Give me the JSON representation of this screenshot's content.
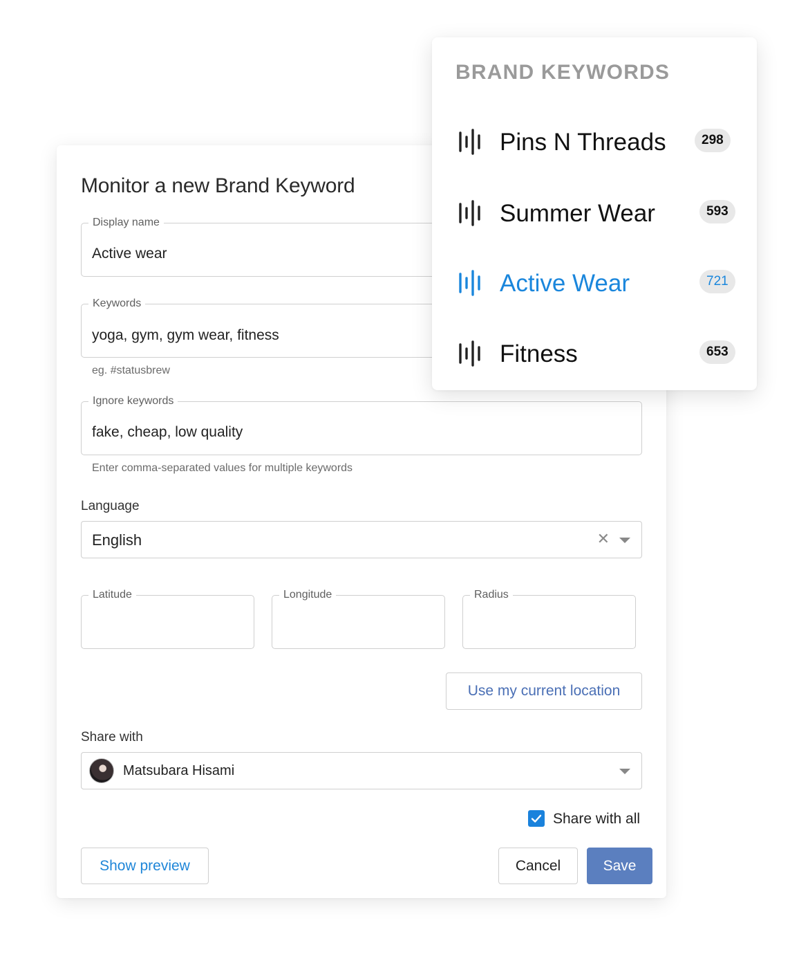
{
  "form": {
    "title": "Monitor a new Brand Keyword",
    "display_name": {
      "label": "Display name",
      "value": "Active wear"
    },
    "keywords": {
      "label": "Keywords",
      "value": "yoga, gym, gym wear, fitness",
      "helper": "eg. #statusbrew"
    },
    "ignore_keywords": {
      "label": "Ignore keywords",
      "value": "fake, cheap, low quality",
      "helper": "Enter comma-separated values for multiple keywords"
    },
    "language": {
      "label": "Language",
      "value": "English",
      "clear_icon": "close-icon",
      "dropdown_icon": "chevron-down-icon"
    },
    "latitude": {
      "label": "Latitude",
      "value": ""
    },
    "longitude": {
      "label": "Longitude",
      "value": ""
    },
    "radius": {
      "label": "Radius",
      "value": ""
    },
    "use_location_label": "Use my current location",
    "share_with": {
      "label": "Share with",
      "user": "Matsubara Hisami",
      "avatar_icon": "avatar"
    },
    "share_with_all": {
      "label": "Share with all",
      "checked": true
    },
    "buttons": {
      "preview": "Show preview",
      "cancel": "Cancel",
      "save": "Save"
    }
  },
  "brand_keywords": {
    "heading": "BRAND KEYWORDS",
    "icon": "waveform-icon",
    "items": [
      {
        "name": "Pins N Threads",
        "count": "298",
        "active": false
      },
      {
        "name": "Summer Wear",
        "count": "593",
        "active": false
      },
      {
        "name": "Active Wear",
        "count": "721",
        "active": true
      },
      {
        "name": "Fitness",
        "count": "653",
        "active": false
      }
    ]
  },
  "colors": {
    "accent": "#1a86dc",
    "save_button": "#5b7fbf",
    "heading_gray": "#9a9a9a",
    "badge_bg": "#e8e8e8"
  }
}
